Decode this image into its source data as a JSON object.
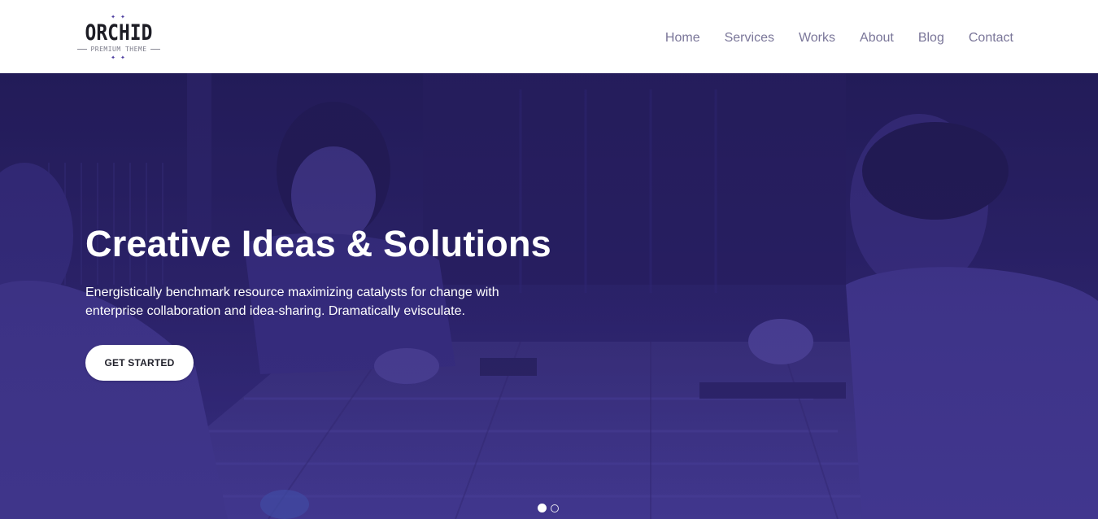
{
  "brand": {
    "name": "ORCHID",
    "tagline": "PREMIUM THEME",
    "accent_color": "#4b3b9e"
  },
  "nav": {
    "items": [
      {
        "label": "Home"
      },
      {
        "label": "Services"
      },
      {
        "label": "Works"
      },
      {
        "label": "About"
      },
      {
        "label": "Blog"
      },
      {
        "label": "Contact"
      }
    ],
    "color": "#7a7699"
  },
  "hero": {
    "title": "Creative Ideas & Solutions",
    "text": "Energistically benchmark resource maximizing catalysts for change with enterprise collaboration and idea-sharing. Dramatically evisculate.",
    "button_label": "GET STARTED",
    "overlay_color": "#2d2466",
    "slides": {
      "count": 2,
      "active": 1
    }
  }
}
